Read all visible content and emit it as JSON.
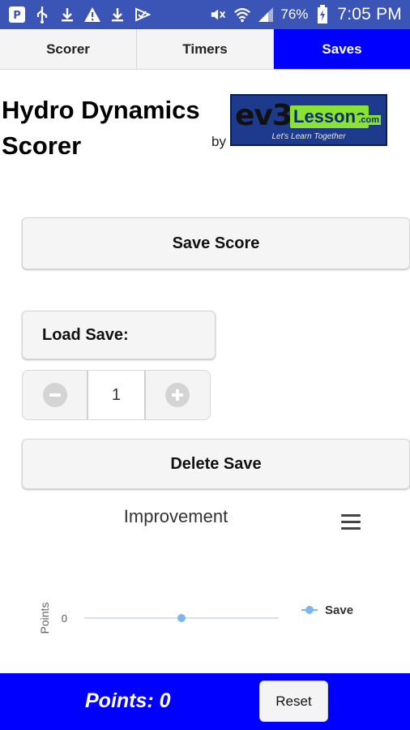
{
  "status_bar": {
    "battery": "76%",
    "time": "7:05 PM",
    "left_icons": [
      "app-icon",
      "usb-icon",
      "download-icon",
      "warning-icon",
      "download-icon",
      "check-icon"
    ],
    "right_icons": [
      "mute-icon",
      "wifi-icon",
      "signal-icon",
      "battery-icon"
    ]
  },
  "tabs": [
    {
      "label": "Scorer",
      "active": false
    },
    {
      "label": "Timers",
      "active": false
    },
    {
      "label": "Saves",
      "active": true
    }
  ],
  "header": {
    "title_line1": "Hydro Dynamics",
    "title_line2": "Scorer",
    "by": "by",
    "logo_text_main": "ev3",
    "logo_text_lessons": "Lessons",
    "logo_text_com": ".com",
    "logo_tagline": "Let's Learn Together"
  },
  "actions": {
    "save_score": "Save Score",
    "load_save": "Load Save:",
    "delete_save": "Delete Save"
  },
  "stepper": {
    "value": "1"
  },
  "chart_data": {
    "type": "line",
    "title": "Improvement",
    "ylabel": "Points",
    "y_ticks": [
      "0"
    ],
    "series": [
      {
        "name": "Save",
        "color": "#7cb5ec",
        "values": [
          0
        ]
      }
    ],
    "legend": "right",
    "grid": false
  },
  "footer": {
    "points_label": "Points: 0",
    "reset_label": "Reset"
  },
  "colors": {
    "accent": "#0000ff",
    "status_bar": "#3a55b6",
    "series": "#7cb5ec"
  }
}
